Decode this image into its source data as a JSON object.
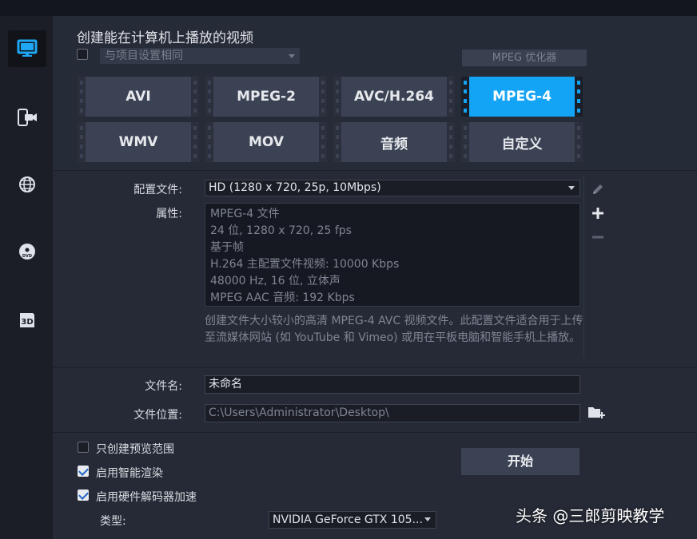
{
  "title": "创建能在计算机上播放的视频",
  "preset": {
    "placeholder": "与项目设置相同",
    "checked": false
  },
  "optimizer_label": "MPEG 优化器",
  "formats": [
    {
      "label": "AVI",
      "selected": false
    },
    {
      "label": "MPEG-2",
      "selected": false
    },
    {
      "label": "AVC/H.264",
      "selected": false
    },
    {
      "label": "MPEG-4",
      "selected": true
    },
    {
      "label": "WMV",
      "selected": false
    },
    {
      "label": "MOV",
      "selected": false
    },
    {
      "label": "音频",
      "selected": false
    },
    {
      "label": "自定义",
      "selected": false
    }
  ],
  "profile": {
    "label": "配置文件:",
    "value": "HD (1280 x 720, 25p, 10Mbps)"
  },
  "properties": {
    "label": "属性:",
    "lines": [
      "MPEG-4 文件",
      "24 位, 1280 x 720, 25 fps",
      "基于帧",
      "H.264 主配置文件视频: 10000 Kbps",
      "48000 Hz, 16 位, 立体声",
      "MPEG AAC 音频: 192 Kbps"
    ]
  },
  "description": "创建文件大小较小的高清 MPEG-4 AVC 视频文件。此配置文件适合用于上传至流媒体网站 (如 YouTube 和 Vimeo) 或用在平板电脑和智能手机上播放。",
  "file": {
    "name_label": "文件名:",
    "name_value": "未命名",
    "location_label": "文件位置:",
    "location_value": "C:\\Users\\Administrator\\Desktop\\"
  },
  "options": [
    {
      "label": "只创建预览范围",
      "checked": false
    },
    {
      "label": "启用智能渲染",
      "checked": true
    },
    {
      "label": "启用硬件解码器加速",
      "checked": true
    }
  ],
  "type": {
    "label": "类型:",
    "value": "NVIDIA GeForce GTX 105..."
  },
  "start_label": "开始",
  "watermark": "头条 @三郎剪映教学",
  "colors": {
    "accent": "#14a4f5",
    "background": "#252a36",
    "sidebar": "#1b1e26"
  },
  "sidebar_icons": [
    "computer-icon",
    "mobile-camera-icon",
    "web-globe-icon",
    "disc-dvd-icon",
    "3d-icon"
  ]
}
